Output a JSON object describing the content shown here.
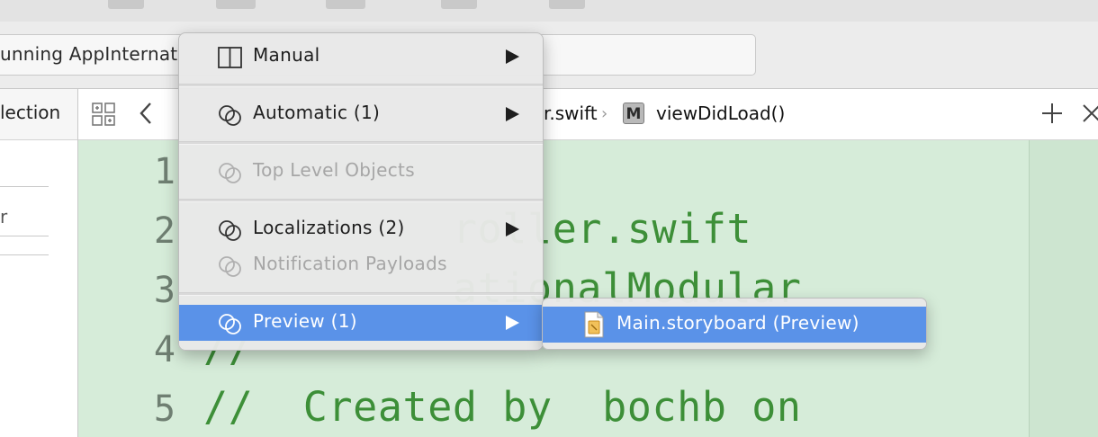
{
  "status": {
    "text": "unning AppInternat"
  },
  "navigator": {
    "header": "lection",
    "field_text": "r"
  },
  "jumpbar": {
    "file_crumb": "r.swift",
    "separator": "›",
    "method_badge": "M",
    "method_crumb": "viewDidLoad()"
  },
  "editor": {
    "lines": [
      {
        "number": "1",
        "code": ""
      },
      {
        "number": "2",
        "code": "          roller.swift"
      },
      {
        "number": "3",
        "code": "          ationalModular"
      },
      {
        "number": "4",
        "code": "//"
      },
      {
        "number": "5",
        "code": "//  Created by  bochb on"
      }
    ]
  },
  "menu": {
    "items": [
      {
        "label": "Manual",
        "icon": "split-view-icon",
        "has_submenu": true,
        "enabled": true
      },
      {
        "label": "Automatic (1)",
        "icon": "linked-circles-icon",
        "has_submenu": true,
        "enabled": true
      },
      {
        "label": "Top Level Objects",
        "icon": "linked-circles-icon",
        "has_submenu": false,
        "enabled": false
      },
      {
        "label": "Localizations (2)",
        "icon": "linked-circles-icon",
        "has_submenu": true,
        "enabled": true
      },
      {
        "label": "Notification Payloads",
        "icon": "linked-circles-icon",
        "has_submenu": false,
        "enabled": false
      },
      {
        "label": "Preview (1)",
        "icon": "linked-circles-icon",
        "has_submenu": true,
        "enabled": true,
        "selected": true
      }
    ],
    "submenu": {
      "label": "Main.storyboard (Preview)",
      "icon": "storyboard-file-icon"
    }
  },
  "colors": {
    "selection": "#5a92e8",
    "editor_background": "#d6ecd9",
    "comment_green": "#3d8f38"
  }
}
